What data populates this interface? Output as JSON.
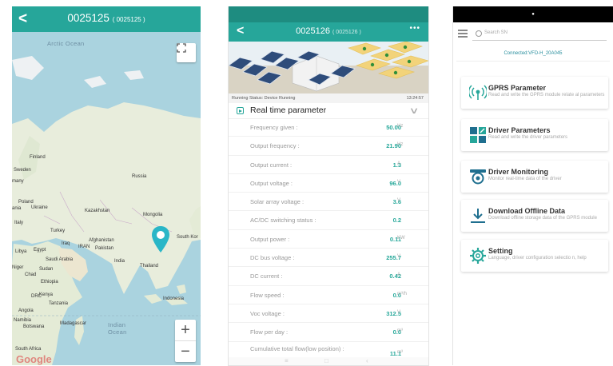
{
  "map_screen": {
    "title": "0025125",
    "title_sub": "( 0025125 )",
    "labels": {
      "arctic_ocean": "Arctic Ocean",
      "indian_ocean_1": "Indian",
      "indian_ocean_2": "Ocean",
      "finland": "Finland",
      "sweden": "Sweden",
      "russia": "Russia",
      "poland": "Poland",
      "ukraine": "Ukraine",
      "kazakhstan": "Kazakhstan",
      "mongolia": "Mongolia",
      "italy": "Italy",
      "turkey": "Turkey",
      "iraq": "Iraq",
      "iran": "IRAN",
      "afghanistan": "Afghanistan",
      "pakistan": "Pakistan",
      "libya": "Libya",
      "egypt": "Egypt",
      "saudi": "Saudi Arabia",
      "india": "India",
      "thailand": "Thailand",
      "south_korea": "South Kor",
      "sudan": "Sudan",
      "chad": "Chad",
      "niger": "Niger",
      "ethiopia": "Ethiopia",
      "kenya": "Kenya",
      "drc": "DRC",
      "tanzania": "Tanzania",
      "angola": "Angola",
      "namibia": "Namibia",
      "botswana": "Botswana",
      "madagascar": "Madagascar",
      "indonesia": "Indonesia",
      "south_africa": "South Africa",
      "google": "Google",
      "many": "many",
      "ania": "ania"
    },
    "zoom_in": "+",
    "zoom_out": "−"
  },
  "param_screen": {
    "title": "0025126",
    "title_sub": "( 0025126 )",
    "more": "•••",
    "running_status": "Running Status:  Device Running",
    "time": "13:24:57",
    "section_title": "Real time parameter",
    "rows": [
      {
        "label": "Frequency given :",
        "value": "50.00",
        "unit": "Hz"
      },
      {
        "label": "Output frequency :",
        "value": "21.90",
        "unit": "Hz"
      },
      {
        "label": "Output current :",
        "value": "1.3",
        "unit": "A"
      },
      {
        "label": "Output voltage :",
        "value": "96.0",
        "unit": "V"
      },
      {
        "label": "Solar array voltage :",
        "value": "3.6",
        "unit": "V"
      },
      {
        "label": "AC/DC switching status :",
        "value": "0.2",
        "unit": ""
      },
      {
        "label": "Output power :",
        "value": "0.11",
        "unit": "KW"
      },
      {
        "label": "DC bus voltage :",
        "value": "255.7",
        "unit": "V"
      },
      {
        "label": "DC current :",
        "value": "0.42",
        "unit": "A"
      },
      {
        "label": "Flow speed :",
        "value": "0.0",
        "unit": "m³/h"
      },
      {
        "label": "Voc voltage :",
        "value": "312.5",
        "unit": "V"
      },
      {
        "label": "Flow per day :",
        "value": "0.0",
        "unit": "m³"
      },
      {
        "label": "Cumulative total flow(low position) :",
        "value": "11.1",
        "unit": "m³"
      }
    ],
    "nav": {
      "menu": "≡",
      "home": "□",
      "back": "‹"
    }
  },
  "menu_screen": {
    "search_placeholder": "Search SN",
    "connected": "Connected:VFD-H_20A045",
    "cards": [
      {
        "title": "GPRS Parameter",
        "desc": "Read and write the GPRS module relate al parameters",
        "icon": "signal-icon"
      },
      {
        "title": "Driver Parameters",
        "desc": "Read and write the driver parameters",
        "icon": "grid-icon"
      },
      {
        "title": "Driver Monitoring",
        "desc": "Monitor real-time data of the driver",
        "icon": "monitor-icon"
      },
      {
        "title": "Download Offline Data",
        "desc": "Download offline storage data of the GPRS module",
        "icon": "download-icon"
      },
      {
        "title": "Setting",
        "desc": "Language, driver configuration selectio n, help",
        "icon": "gear-icon"
      }
    ]
  },
  "colors": {
    "teal": "#26a69a",
    "value_teal": "#27a89a",
    "pin": "#29b6c7",
    "map_water": "#aad3df",
    "land": "#e3ead8"
  }
}
